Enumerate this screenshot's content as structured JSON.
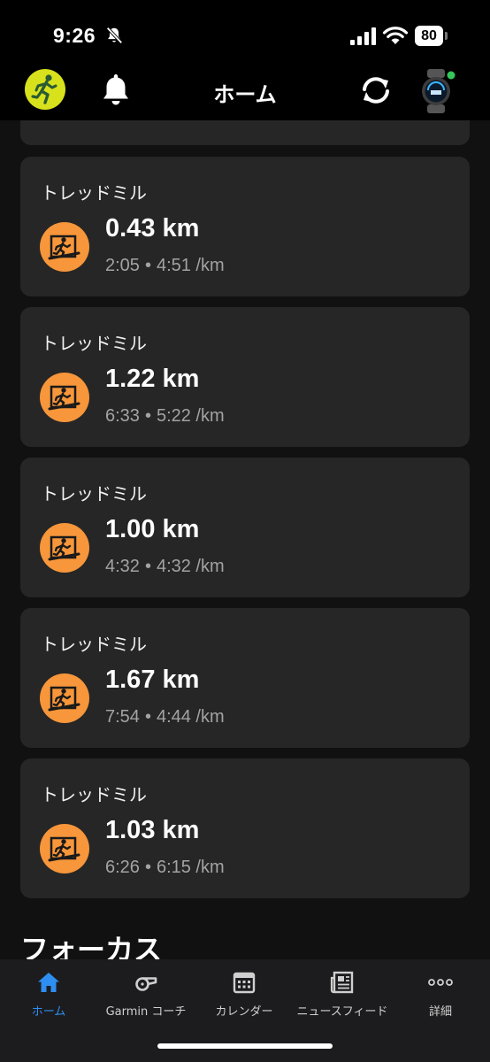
{
  "status_bar": {
    "time": "9:26",
    "battery": "80"
  },
  "header": {
    "title": "ホーム"
  },
  "activities": [
    {
      "title": "トレッドミル",
      "distance": "0.43 km",
      "duration": "2:05",
      "separator": "•",
      "pace": "4:51 /km"
    },
    {
      "title": "トレッドミル",
      "distance": "1.22 km",
      "duration": "6:33",
      "separator": "•",
      "pace": "5:22 /km"
    },
    {
      "title": "トレッドミル",
      "distance": "1.00 km",
      "duration": "4:32",
      "separator": "•",
      "pace": "4:32 /km"
    },
    {
      "title": "トレッドミル",
      "distance": "1.67 km",
      "duration": "7:54",
      "separator": "•",
      "pace": "4:44 /km"
    },
    {
      "title": "トレッドミル",
      "distance": "1.03 km",
      "duration": "6:26",
      "separator": "•",
      "pace": "6:15 /km"
    }
  ],
  "focus": {
    "heading": "フォーカス"
  },
  "tabs": [
    {
      "label": "ホーム",
      "icon": "home-icon",
      "active": true
    },
    {
      "label": "Garmin コーチ",
      "icon": "whistle-icon",
      "active": false
    },
    {
      "label": "カレンダー",
      "icon": "calendar-icon",
      "active": false
    },
    {
      "label": "ニュースフィード",
      "icon": "newsfeed-icon",
      "active": false
    },
    {
      "label": "詳細",
      "icon": "more-icon",
      "active": false
    }
  ],
  "colors": {
    "accent": "#2e8ef2",
    "activity_icon": "#f7963a",
    "avatar": "#d8e21c",
    "card": "#262626",
    "watch_status": "#34c759"
  }
}
